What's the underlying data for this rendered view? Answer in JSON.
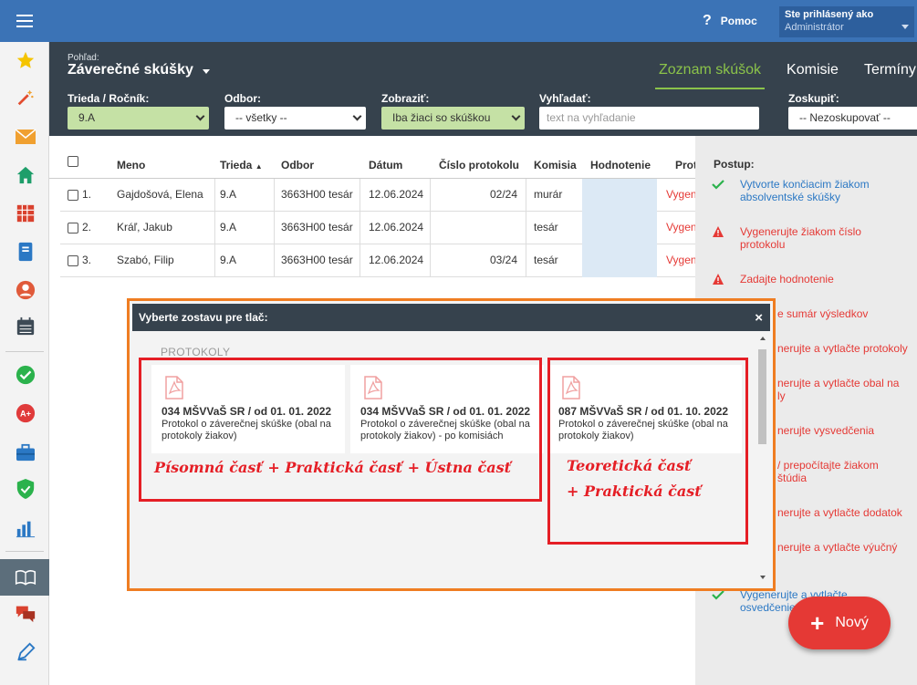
{
  "topbar": {
    "help_label": "Pomoc",
    "user_line1": "Ste prihlásený ako",
    "user_line2": "Administrátor"
  },
  "header": {
    "view_label": "Pohľad:",
    "view_title": "Záverečné skúšky",
    "tabs": [
      "Zoznam skúšok",
      "Komisie",
      "Termíny"
    ]
  },
  "filters": {
    "class_label": "Trieda / Ročník:",
    "class_value": "9.A",
    "field_label": "Odbor:",
    "field_value": "-- všetky --",
    "show_label": "Zobraziť:",
    "show_value": "Iba žiaci so skúškou",
    "search_label": "Vyhľadať:",
    "search_placeholder": "text na vyhľadanie",
    "group_label": "Zoskupiť:",
    "group_value": "-- Nezoskupovať --"
  },
  "table": {
    "headers": [
      "Meno",
      "Trieda",
      "Odbor",
      "Dátum",
      "Číslo protokolu",
      "Komisia",
      "Hodnotenie",
      "Prot"
    ],
    "sort_indicator": "▲",
    "rows": [
      {
        "num": "1.",
        "name": "Gajdošová, Elena",
        "class": "9.A",
        "field": "3663H00 tesár",
        "date": "12.06.2024",
        "protocol": "02/24",
        "commission": "murár",
        "link": "Vygen"
      },
      {
        "num": "2.",
        "name": "Kráľ, Jakub",
        "class": "9.A",
        "field": "3663H00 tesár",
        "date": "12.06.2024",
        "protocol": "",
        "commission": "tesár",
        "link": "Vygen"
      },
      {
        "num": "3.",
        "name": "Szabó, Filip",
        "class": "9.A",
        "field": "3663H00 tesár",
        "date": "12.06.2024",
        "protocol": "03/24",
        "commission": "tesár",
        "link": "Vygen"
      }
    ]
  },
  "steps": {
    "title": "Postup:",
    "items": [
      {
        "text": "Vytvorte končiacim žiakom absolventské skúšky",
        "status": "done"
      },
      {
        "text": "Vygenerujte žiakom číslo protokolu",
        "status": "warn"
      },
      {
        "text": "Zadajte hodnotenie",
        "status": "warn"
      },
      {
        "text": "e sumár výsledkov",
        "status": "hidden"
      },
      {
        "text": "nerujte a vytlačte protokoly",
        "status": "hidden"
      },
      {
        "text": "nerujte a vytlačte obal na",
        "status": "hidden"
      },
      {
        "text": "ly",
        "status": "hidden"
      },
      {
        "text": "nerujte vysvedčenia",
        "status": "hidden"
      },
      {
        "text": "/ prepočítajte žiakom",
        "status": "hidden"
      },
      {
        "text": "štúdia",
        "status": "hidden"
      },
      {
        "text": "nerujte a vytlačte dodatok",
        "status": "hidden"
      },
      {
        "text": "nerujte a vytlačte výučný",
        "status": "hidden"
      },
      {
        "text": "Vygenerujte a vytlačte",
        "status": "done"
      },
      {
        "text": "osvedčenie",
        "status": "done"
      }
    ]
  },
  "new_button": {
    "label": "Nový"
  },
  "modal": {
    "title": "Vyberte zostavu pre tlač:",
    "close": "×",
    "section": "PROTOKOLY",
    "cards": [
      {
        "title": "034 MŠVVaŠ SR / od 01. 01. 2022",
        "subtitle": "Protokol o záverečnej skúške (obal na protokoly žiakov)"
      },
      {
        "title": "034 MŠVVaŠ SR / od 01. 01. 2022",
        "subtitle": "Protokol o záverečnej skúške (obal na protokoly žiakov) - po komisiách"
      },
      {
        "title": "087 MŠVVaŠ SR / od 01. 10. 2022",
        "subtitle": "Protokol o záverečnej skúške (obal na protokoly žiakov)"
      }
    ],
    "annotation_left": "Písomná časť + Praktická časť + Ústna časť",
    "annotation_right_line1": "Teoretická časť",
    "annotation_right_line2": "+ Praktická časť"
  },
  "colors": {
    "brand_blue": "#3b73b6",
    "header_dark": "#36424d",
    "accent_green": "#8bc34a",
    "danger_red": "#e53935",
    "modal_border": "#ef7d22"
  }
}
